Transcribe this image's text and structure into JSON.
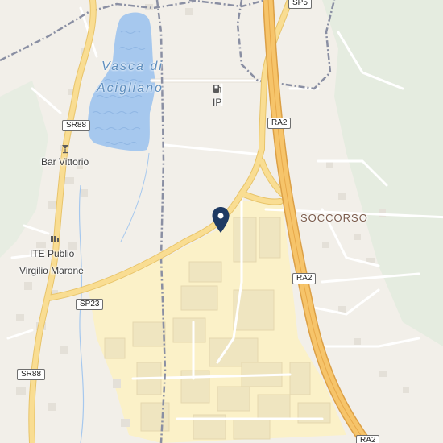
{
  "map": {
    "water": {
      "name_line1": "Vasca di",
      "name_line2": "Acigliano"
    },
    "places": {
      "fuel_brand": "IP",
      "bar": "Bar Vittorio",
      "school_line1": "ITE Publio",
      "school_line2": "Virgilio Marone",
      "district": "SOCCORSO"
    },
    "roads": {
      "sp5": "SP5",
      "ra2_top": "RA2",
      "ra2_mid": "RA2",
      "ra2_bottom": "RA2",
      "sr88_top": "SR88",
      "sr88_bottom": "SR88",
      "sp23": "SP23"
    },
    "icons": {
      "fuel": "fuel-station-icon",
      "bar": "bar-icon",
      "school": "school-icon",
      "marker": "location-pin-icon"
    },
    "colors": {
      "background": "#f2efe9",
      "water": "#a6c8ee",
      "industrial": "#fbf1c8",
      "highway": "#f6c46a",
      "main_road": "#f9dd92",
      "boundary": "#8a8fa3",
      "marker": "#1f3a63"
    }
  }
}
